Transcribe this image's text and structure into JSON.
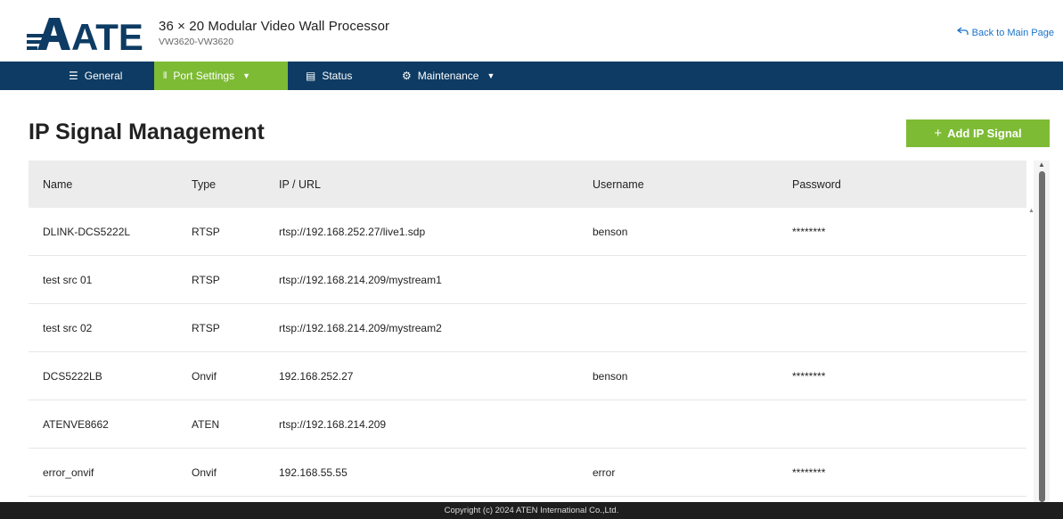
{
  "header": {
    "logo_text": "ATEN",
    "title": "36 × 20 Modular Video Wall Processor",
    "subtitle": "VW3620-VW3620",
    "back_link": "Back to Main Page"
  },
  "nav": {
    "items": [
      {
        "label": "General",
        "icon": "list-icon",
        "active": false
      },
      {
        "label": "Port Settings",
        "icon": "ports-icon",
        "active": true,
        "dropdown": true
      },
      {
        "label": "Status",
        "icon": "status-icon",
        "active": false
      },
      {
        "label": "Maintenance",
        "icon": "gear-icon",
        "active": false,
        "dropdown": true
      }
    ]
  },
  "main": {
    "title": "IP Signal Management",
    "add_button": "Add IP Signal"
  },
  "table": {
    "columns": [
      "Name",
      "Type",
      "IP / URL",
      "Username",
      "Password"
    ],
    "rows": [
      [
        "DLINK-DCS5222L",
        "RTSP",
        "rtsp://192.168.252.27/live1.sdp",
        "benson",
        "********"
      ],
      [
        "test src 01",
        "RTSP",
        "rtsp://192.168.214.209/mystream1",
        "",
        ""
      ],
      [
        "test src 02",
        "RTSP",
        "rtsp://192.168.214.209/mystream2",
        "",
        ""
      ],
      [
        "DCS5222LB",
        "Onvif",
        "192.168.252.27",
        "benson",
        "********"
      ],
      [
        "ATENVE8662",
        "ATEN",
        "rtsp://192.168.214.209",
        "",
        ""
      ],
      [
        "error_onvif",
        "Onvif",
        "192.168.55.55",
        "error",
        "********"
      ]
    ]
  },
  "footer": {
    "copyright": "Copyright (c) 2024 ATEN International Co.,Ltd."
  },
  "colors": {
    "nav_bg": "#0d3b63",
    "accent_green": "#7dbb35",
    "link_blue": "#1a73c9",
    "logo_blue": "#0d3b63",
    "footer_bg": "#1e1e1e"
  }
}
